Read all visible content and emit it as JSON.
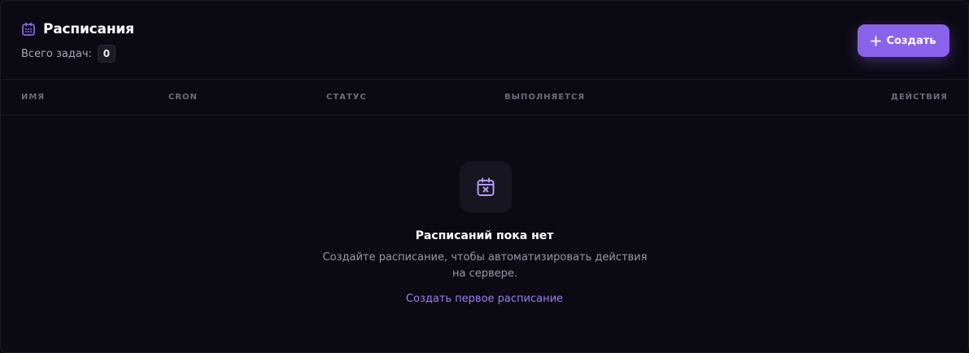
{
  "header": {
    "title": "Расписания",
    "count_label": "Всего задач:",
    "count_value": "0",
    "create_button_label": "Создать",
    "accent_color": "#8a63ea",
    "title_icon": "calendar-icon",
    "create_icon": "plus-icon"
  },
  "table": {
    "columns": [
      "ИМЯ",
      "CRON",
      "СТАТУС",
      "ВЫПОЛНЯЕТСЯ",
      "ДЕЙСТВИЯ"
    ]
  },
  "empty_state": {
    "icon": "calendar-x-icon",
    "title": "Расписаний пока нет",
    "description_line1": "Создайте расписание, чтобы автоматизировать действия",
    "description_line2": "на сервере.",
    "link_label": "Создать первое расписание"
  }
}
